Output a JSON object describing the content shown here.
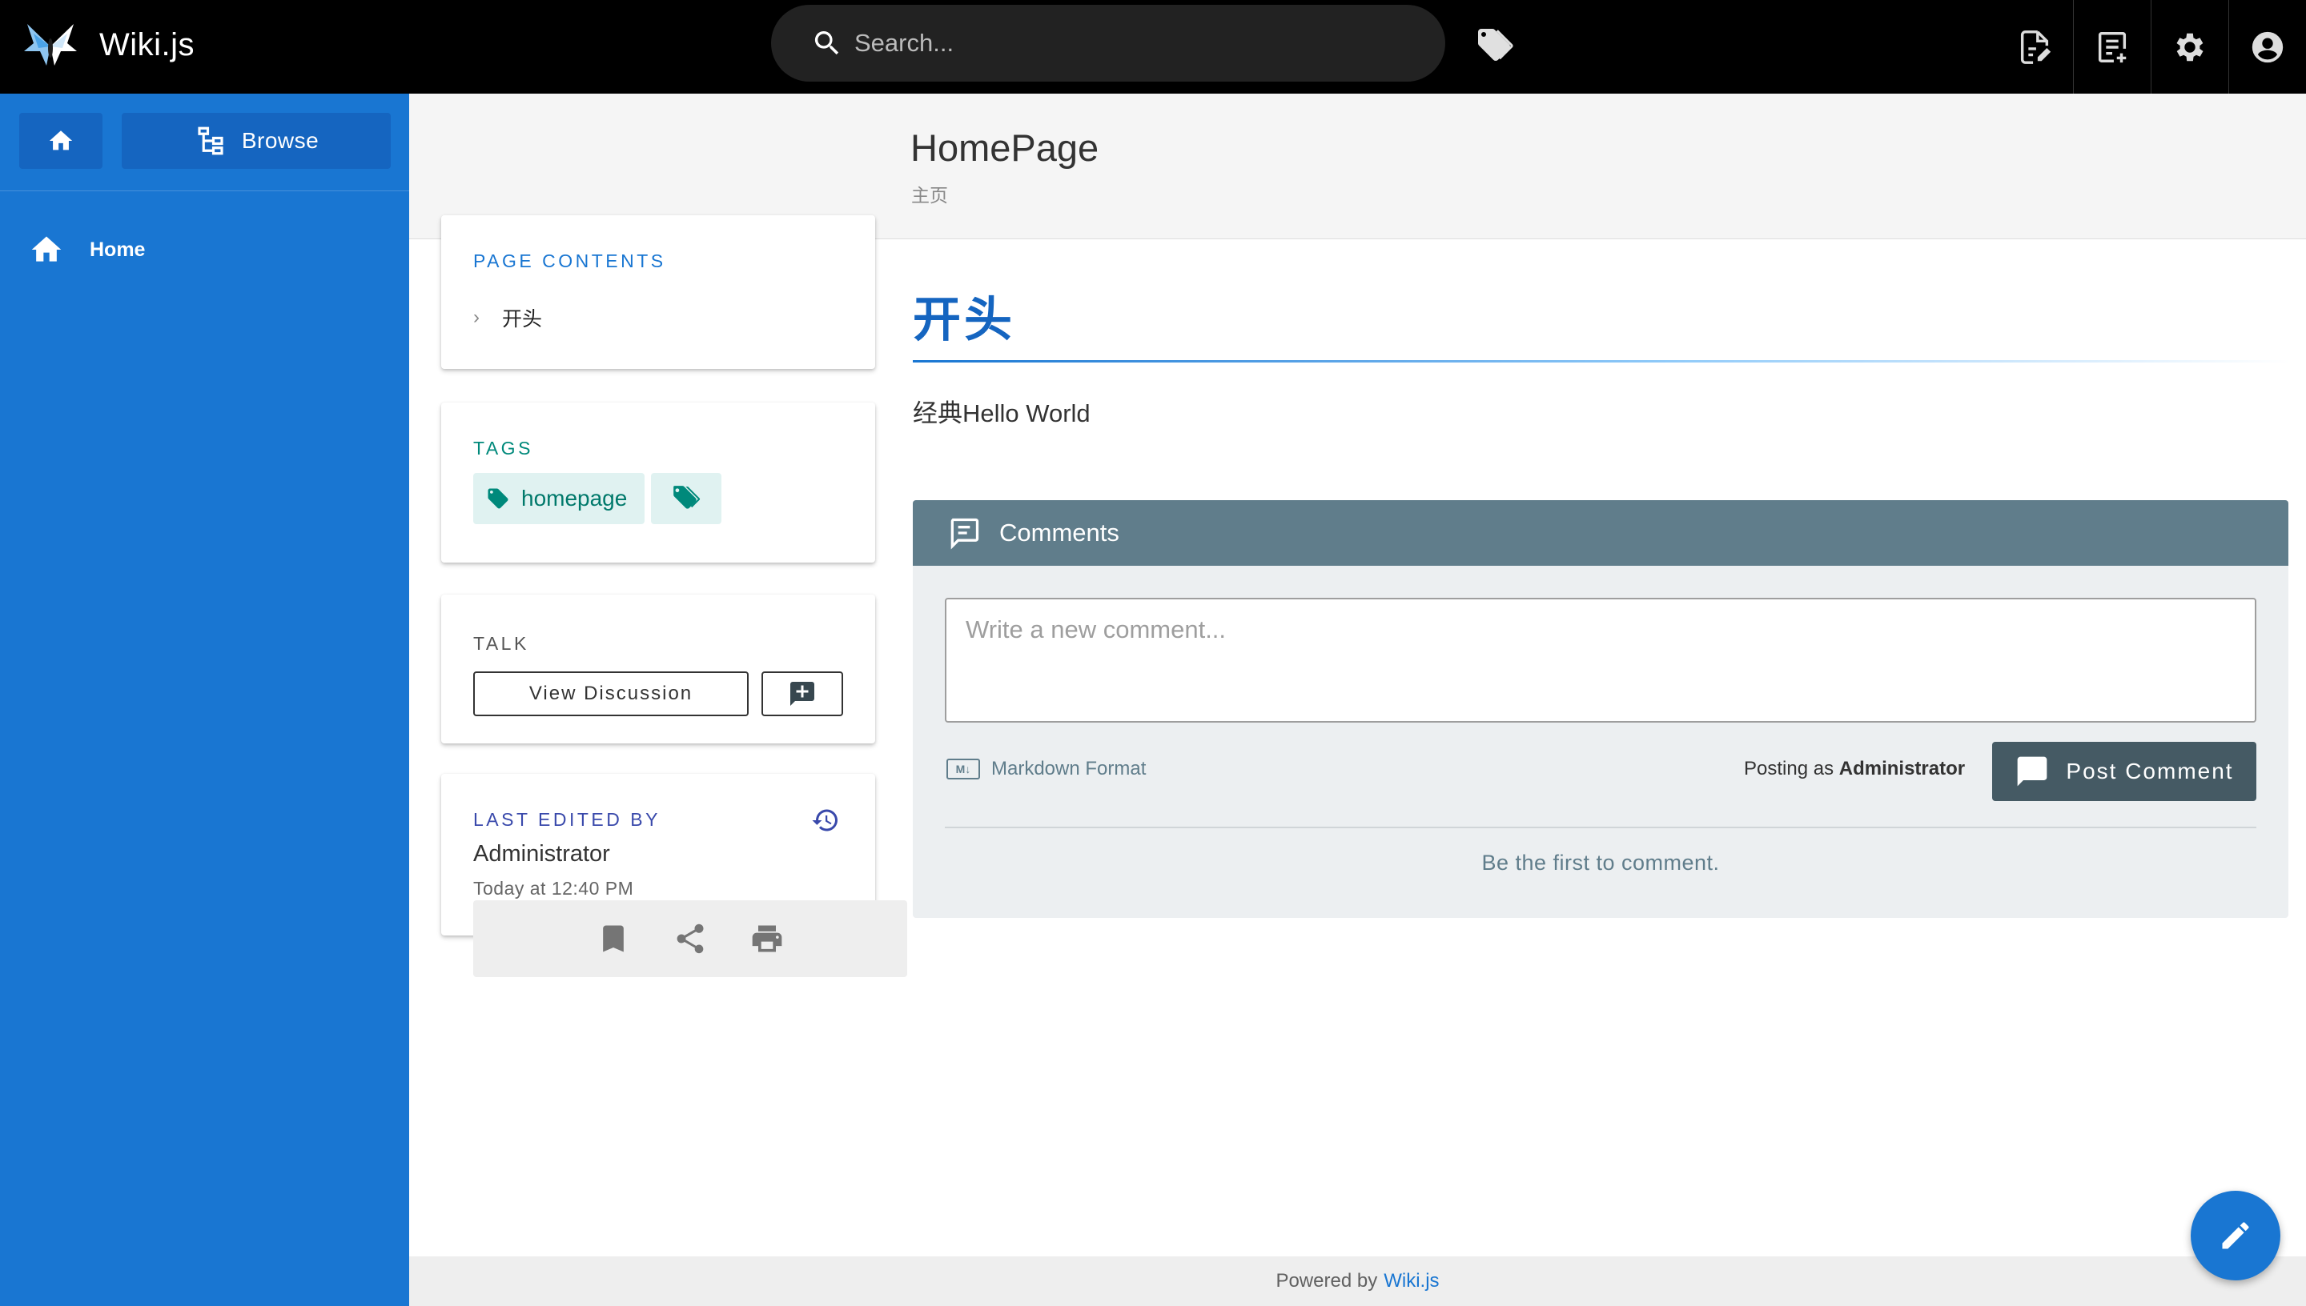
{
  "app": {
    "name": "Wiki.js"
  },
  "search": {
    "placeholder": "Search..."
  },
  "topbar": {
    "icons": [
      "tags-icon",
      "new-page-icon",
      "page-actions-icon",
      "admin-gear-icon",
      "account-icon"
    ]
  },
  "sidebar": {
    "browse_label": "Browse",
    "items": [
      {
        "label": "Home",
        "icon": "home-icon"
      }
    ]
  },
  "page": {
    "title": "HomePage",
    "subtitle": "主页"
  },
  "toc": {
    "label": "PAGE CONTENTS",
    "items": [
      "开头"
    ]
  },
  "tags": {
    "label": "TAGS",
    "items": [
      "homepage"
    ]
  },
  "talk": {
    "label": "TALK",
    "view_discussion": "View Discussion"
  },
  "last_edited": {
    "label": "LAST EDITED BY",
    "user": "Administrator",
    "time": "Today at 12:40 PM"
  },
  "content": {
    "heading": "开头",
    "paragraph": "经典Hello World"
  },
  "comments": {
    "title": "Comments",
    "placeholder": "Write a new comment...",
    "markdown_label": "Markdown Format",
    "posting_prefix": "Posting as",
    "posting_user": "Administrator",
    "post_button": "Post Comment",
    "empty_message": "Be the first to comment."
  },
  "footer": {
    "prefix": "Powered by",
    "link": "Wiki.js"
  },
  "colors": {
    "sidebar": "#1976d2",
    "topbar": "#000000",
    "comments_header": "#607d8b",
    "tag_chip": "#e0f2f1"
  }
}
